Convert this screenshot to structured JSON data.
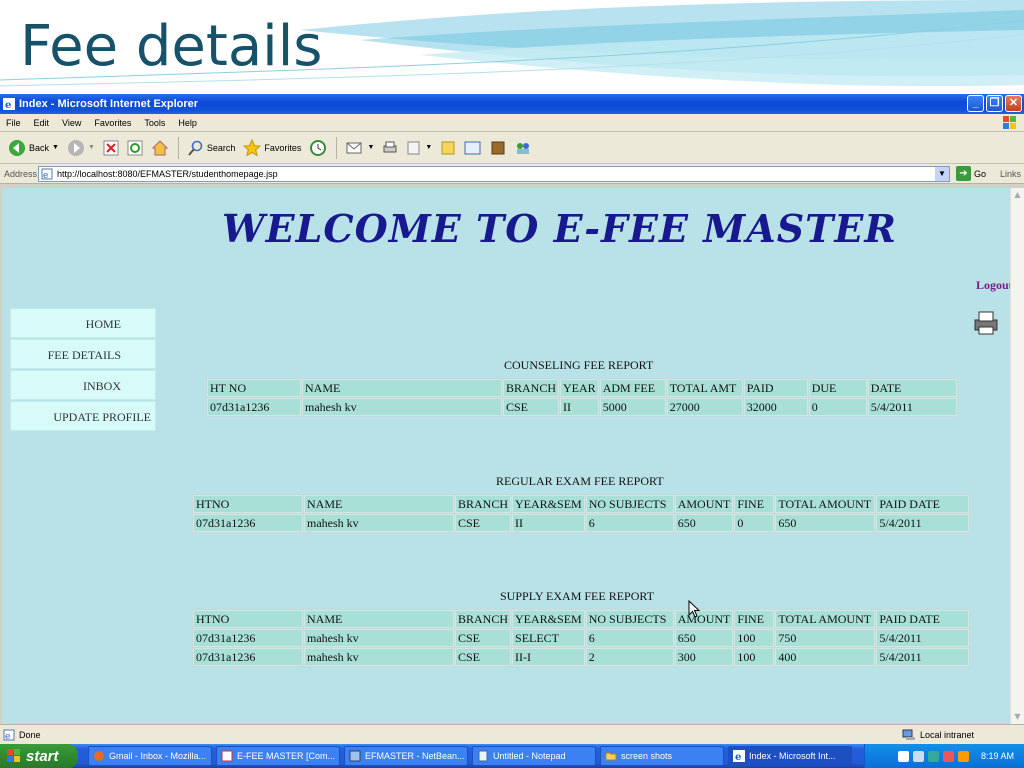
{
  "slide": {
    "title": "Fee details"
  },
  "window": {
    "title": "Index - Microsoft Internet Explorer",
    "menu": [
      "File",
      "Edit",
      "View",
      "Favorites",
      "Tools",
      "Help"
    ],
    "toolbar": {
      "back": "Back",
      "search": "Search",
      "favorites": "Favorites"
    },
    "address": {
      "label": "Address",
      "url": "http://localhost:8080/EFMASTER/studenthomepage.jsp",
      "go": "Go",
      "links": "Links"
    },
    "status": {
      "left": "Done",
      "zone": "Local intranet"
    }
  },
  "page": {
    "welcome": "WELCOME TO E-FEE MASTER",
    "logout": "Logout",
    "nav": [
      "HOME",
      "FEE DETAILS",
      "INBOX",
      "UPDATE PROFILE"
    ],
    "reports": [
      {
        "title": "COUNSELING FEE REPORT",
        "headers": [
          "HT NO",
          "NAME",
          "BRANCH",
          "YEAR",
          "ADM FEE",
          "TOTAL AMT",
          "PAID",
          "DUE",
          "DATE"
        ],
        "rows": [
          [
            "07d31a1236",
            "mahesh kv",
            "CSE",
            "II",
            "5000",
            "27000",
            "32000",
            "0",
            "5/4/2011"
          ]
        ]
      },
      {
        "title": "REGULAR EXAM FEE REPORT",
        "headers": [
          "HTNO",
          "NAME",
          "BRANCH",
          "YEAR&SEM",
          "NO SUBJECTS",
          "AMOUNT",
          "FINE",
          "TOTAL AMOUNT",
          "PAID DATE"
        ],
        "rows": [
          [
            "07d31a1236",
            "mahesh kv",
            "CSE",
            "II",
            "6",
            "650",
            "0",
            "650",
            "5/4/2011"
          ]
        ]
      },
      {
        "title": "SUPPLY EXAM FEE REPORT",
        "headers": [
          "HTNO",
          "NAME",
          "BRANCH",
          "YEAR&SEM",
          "NO SUBJECTS",
          "AMOUNT",
          "FINE",
          "TOTAL AMOUNT",
          "PAID DATE"
        ],
        "rows": [
          [
            "07d31a1236",
            "mahesh kv",
            "CSE",
            "SELECT",
            "6",
            "650",
            "100",
            "750",
            "5/4/2011"
          ],
          [
            "07d31a1236",
            "mahesh kv",
            "CSE",
            "II-I",
            "2",
            "300",
            "100",
            "400",
            "5/4/2011"
          ]
        ]
      }
    ]
  },
  "taskbar": {
    "start": "start",
    "tasks": [
      "Gmail - Inbox - Mozilla...",
      "E-FEE MASTER [Com...",
      "EFMASTER - NetBean...",
      "Untitled - Notepad",
      "screen shots",
      "Index - Microsoft Int..."
    ],
    "clock": "8:19 AM"
  },
  "colors": {
    "slide_title": "#17526b",
    "page_bg": "#b9e2e8",
    "welcome": "#19198f",
    "logout": "#7a1d8a",
    "cell_bg": "#a8e0d8",
    "nav_bg": "#d6fbf9",
    "titlebar": "#0d4ad6"
  }
}
